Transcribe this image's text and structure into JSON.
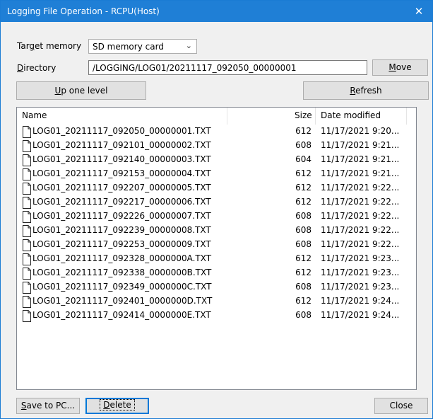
{
  "window": {
    "title": "Logging File Operation - RCPU(Host)",
    "close_icon": "✕"
  },
  "target_memory": {
    "label_pre": "Tar",
    "label_key": "g",
    "label_post": "et memory",
    "value": "SD memory card"
  },
  "directory": {
    "label_key": "D",
    "label_post": "irectory",
    "value": "/LOGGING/LOG01/20211117_092050_00000001"
  },
  "buttons": {
    "move_key": "M",
    "move_rest": "ove",
    "up_key": "U",
    "up_rest": "p one level",
    "refresh_key": "R",
    "refresh_rest": "efresh",
    "save_key": "S",
    "save_rest": "ave to PC...",
    "delete_key": "D",
    "delete_rest": "elete",
    "close": "Close"
  },
  "columns": {
    "name": "Name",
    "size": "Size",
    "date": "Date modified"
  },
  "files": [
    {
      "name": "LOG01_20211117_092050_00000001.TXT",
      "size": "612",
      "date": "11/17/2021 9:20..."
    },
    {
      "name": "LOG01_20211117_092101_00000002.TXT",
      "size": "608",
      "date": "11/17/2021 9:21..."
    },
    {
      "name": "LOG01_20211117_092140_00000003.TXT",
      "size": "604",
      "date": "11/17/2021 9:21..."
    },
    {
      "name": "LOG01_20211117_092153_00000004.TXT",
      "size": "612",
      "date": "11/17/2021 9:21..."
    },
    {
      "name": "LOG01_20211117_092207_00000005.TXT",
      "size": "612",
      "date": "11/17/2021 9:22..."
    },
    {
      "name": "LOG01_20211117_092217_00000006.TXT",
      "size": "612",
      "date": "11/17/2021 9:22..."
    },
    {
      "name": "LOG01_20211117_092226_00000007.TXT",
      "size": "608",
      "date": "11/17/2021 9:22..."
    },
    {
      "name": "LOG01_20211117_092239_00000008.TXT",
      "size": "608",
      "date": "11/17/2021 9:22..."
    },
    {
      "name": "LOG01_20211117_092253_00000009.TXT",
      "size": "608",
      "date": "11/17/2021 9:22..."
    },
    {
      "name": "LOG01_20211117_092328_0000000A.TXT",
      "size": "612",
      "date": "11/17/2021 9:23..."
    },
    {
      "name": "LOG01_20211117_092338_0000000B.TXT",
      "size": "612",
      "date": "11/17/2021 9:23..."
    },
    {
      "name": "LOG01_20211117_092349_0000000C.TXT",
      "size": "608",
      "date": "11/17/2021 9:23..."
    },
    {
      "name": "LOG01_20211117_092401_0000000D.TXT",
      "size": "612",
      "date": "11/17/2021 9:24..."
    },
    {
      "name": "LOG01_20211117_092414_0000000E.TXT",
      "size": "608",
      "date": "11/17/2021 9:24..."
    }
  ]
}
